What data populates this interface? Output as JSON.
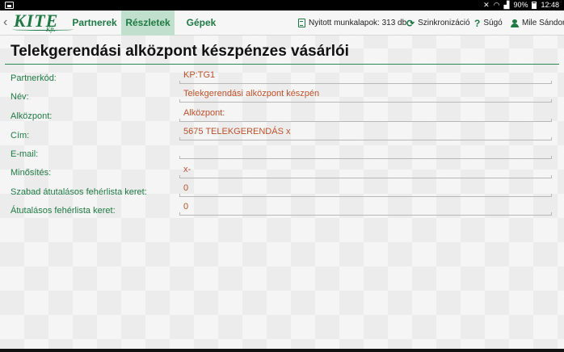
{
  "status_bar": {
    "battery": "90%",
    "time": "12:48"
  },
  "header": {
    "logo": {
      "name": "KITE",
      "sub": "Kft."
    },
    "tabs": [
      {
        "label": "Partnerek",
        "active": false
      },
      {
        "label": "Részletek",
        "active": true
      },
      {
        "label": "Gépek",
        "active": false
      }
    ],
    "tools": {
      "open_worksheets": "Nyitott munkalapok: 313 db",
      "sync": "Szinkronizáció",
      "help": "Súgó",
      "user": "Mile Sándor"
    }
  },
  "page": {
    "title": "Telekgerendási alközpont készpénzes vásárlói"
  },
  "fields": [
    {
      "label": "Partnerkód:",
      "value": "KP:TG1"
    },
    {
      "label": "Név:",
      "value": "Telekgerendási alközpont készpén"
    },
    {
      "label": "Alközpont:",
      "value": "Alközpont:"
    },
    {
      "label": "Cím:",
      "value": "5675 TELEKGERENDÁS x"
    },
    {
      "label": "E-mail:",
      "value": ""
    },
    {
      "label": "Minősítés:",
      "value": "x-"
    },
    {
      "label": "Szabad átutalásos fehérlista keret:",
      "value": "0"
    },
    {
      "label": "Átutalásos fehérlista keret:",
      "value": "0"
    }
  ],
  "colors": {
    "accent": "#1e7a43",
    "active_tab_bg": "#c0e0cd",
    "value_text": "#c0502a"
  }
}
